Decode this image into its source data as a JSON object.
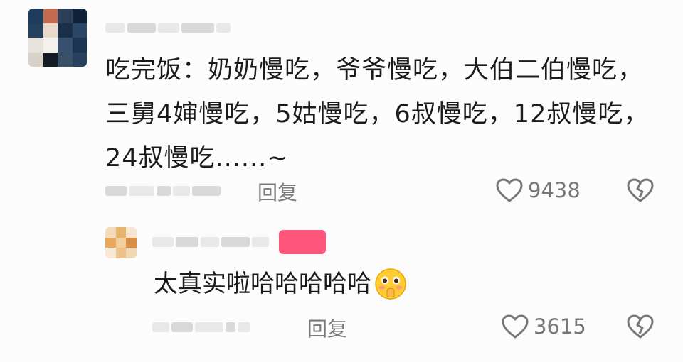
{
  "comment": {
    "text": "吃完饭：奶奶慢吃，爷爷慢吃，大伯二伯慢吃，三舅4婶慢吃，5姑慢吃，6叔慢吃，12叔慢吃，24叔慢吃......~",
    "reply_label": "回复",
    "like_count": "9438"
  },
  "reply": {
    "text": "太真实啦哈哈哈哈哈",
    "reply_label": "回复",
    "like_count": "3615"
  },
  "icons": {
    "like": "heart-outline-icon",
    "dislike": "broken-heart-icon",
    "emoji": "blushing-face-emoji"
  },
  "colors": {
    "text": "#1b1b1b",
    "muted": "#777777",
    "badge": "#ff3a64"
  }
}
